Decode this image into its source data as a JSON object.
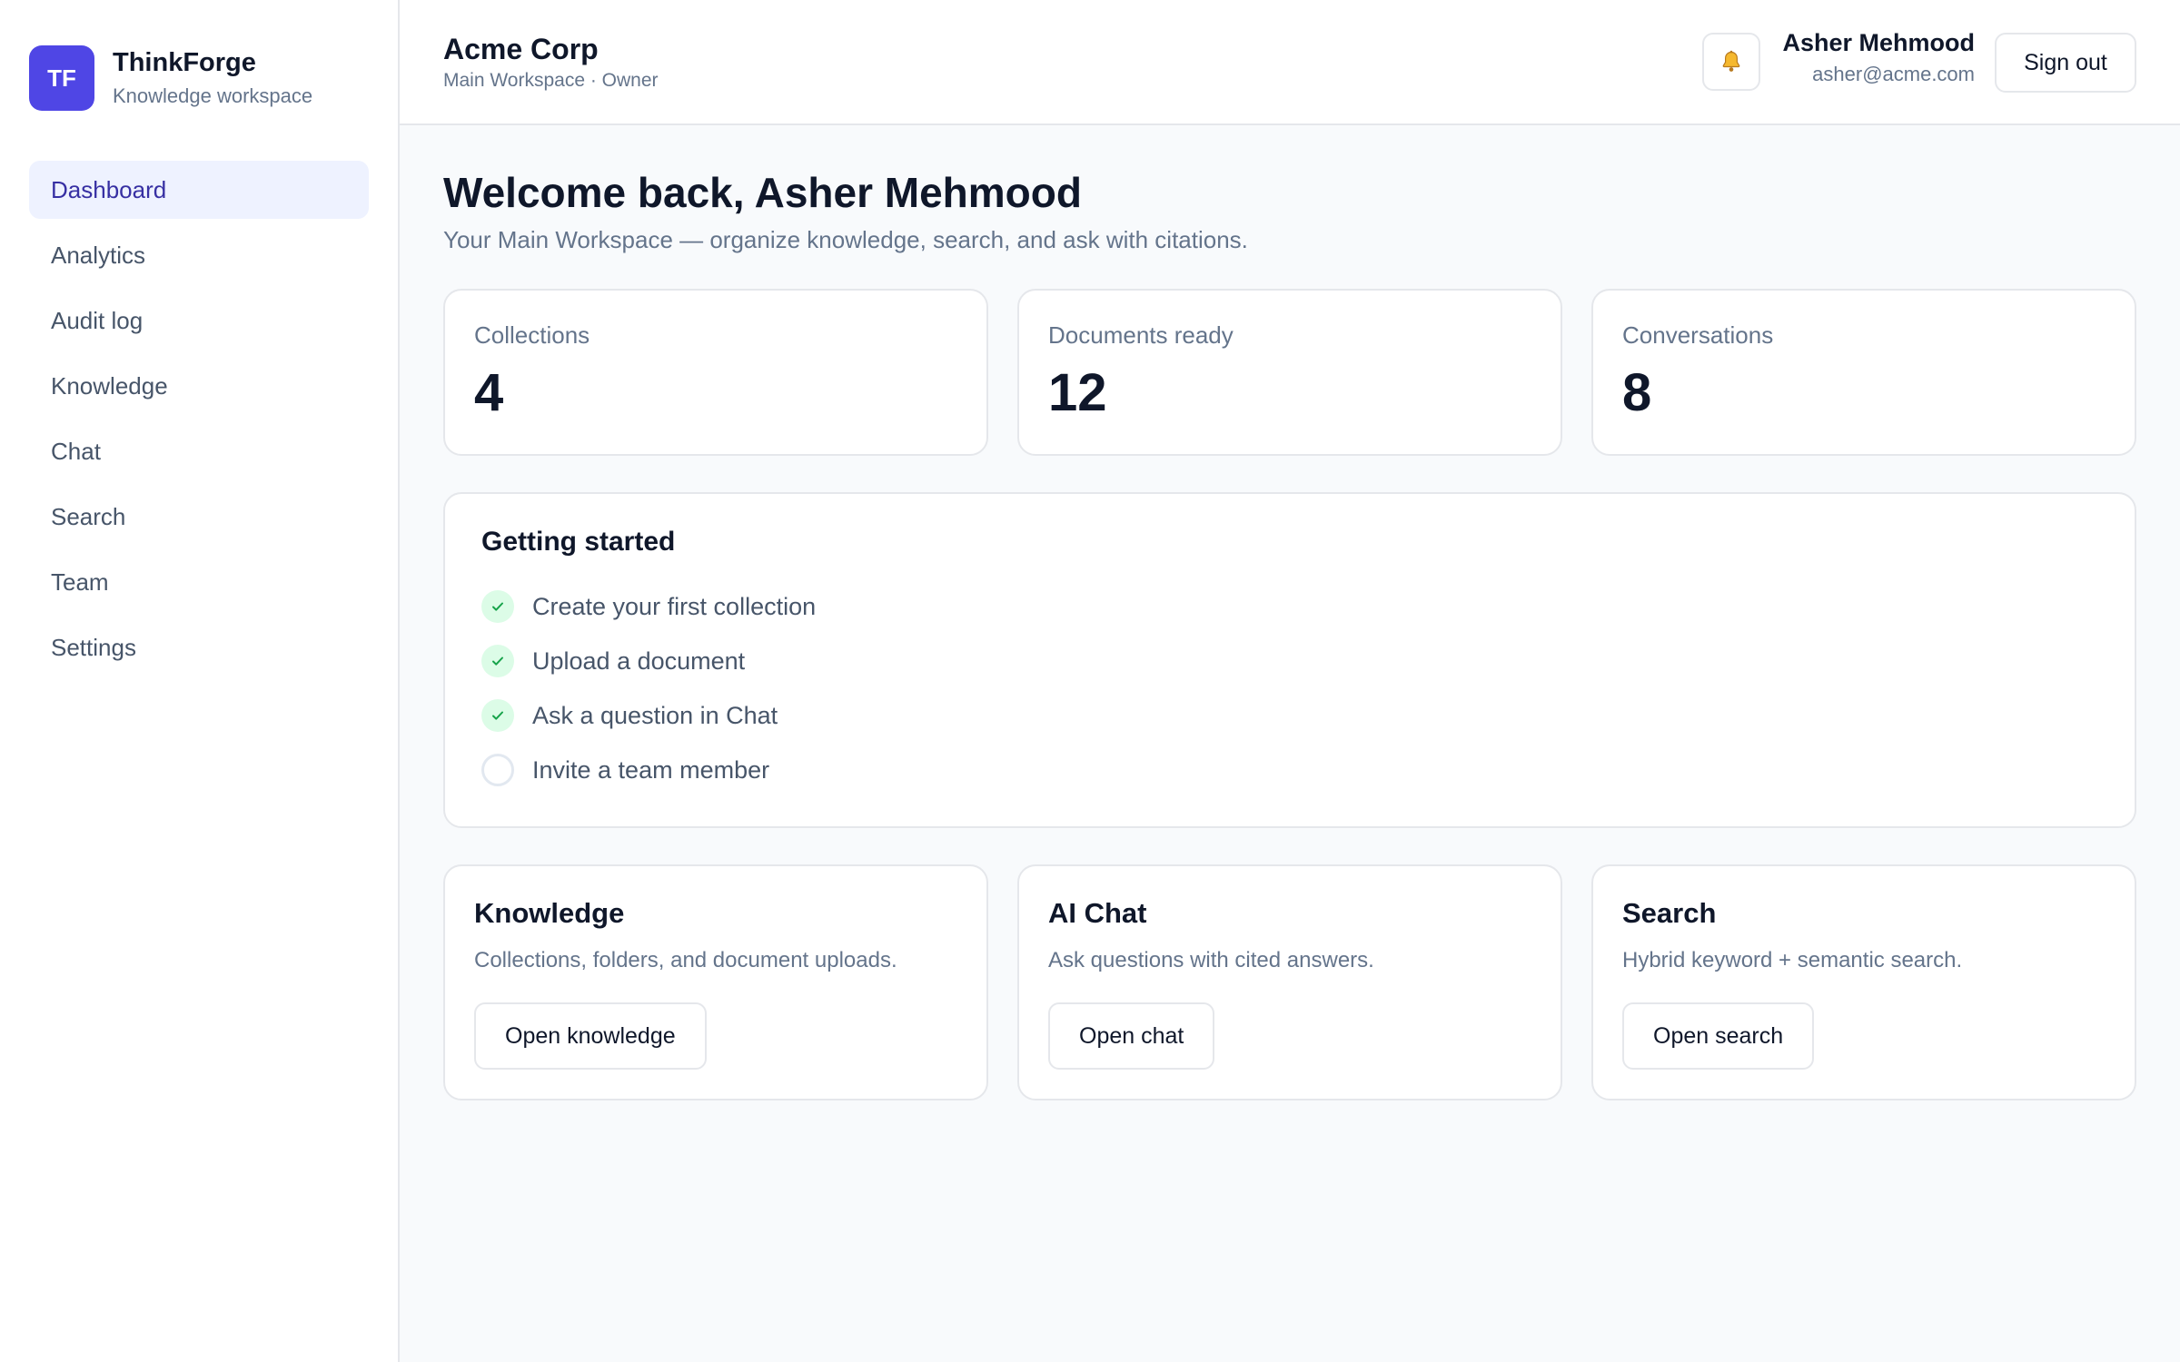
{
  "brand": {
    "logo": "TF",
    "name": "ThinkForge",
    "subtitle": "Knowledge workspace"
  },
  "nav": {
    "items": [
      {
        "label": "Dashboard",
        "active": true
      },
      {
        "label": "Analytics"
      },
      {
        "label": "Audit log"
      },
      {
        "label": "Knowledge"
      },
      {
        "label": "Chat"
      },
      {
        "label": "Search"
      },
      {
        "label": "Team"
      },
      {
        "label": "Settings"
      }
    ]
  },
  "header": {
    "org_name": "Acme Corp",
    "org_sub": "Main Workspace · Owner",
    "notifications_icon": "bell-icon",
    "user_name": "Asher Mehmood",
    "user_email": "asher@acme.com",
    "signout_label": "Sign out"
  },
  "welcome": {
    "title": "Welcome back, Asher Mehmood",
    "subtitle": "Your Main Workspace — organize knowledge, search, and ask with citations."
  },
  "stats": [
    {
      "label": "Collections",
      "value": "4"
    },
    {
      "label": "Documents ready",
      "value": "12"
    },
    {
      "label": "Conversations",
      "value": "8"
    }
  ],
  "getting_started": {
    "title": "Getting started",
    "items": [
      {
        "label": "Create your first collection",
        "done": true
      },
      {
        "label": "Upload a document",
        "done": true
      },
      {
        "label": "Ask a question in Chat",
        "done": true
      },
      {
        "label": "Invite a team member",
        "done": false
      }
    ]
  },
  "modules": [
    {
      "title": "Knowledge",
      "description": "Collections, folders, and document uploads.",
      "button": "Open knowledge"
    },
    {
      "title": "AI Chat",
      "description": "Ask questions with cited answers.",
      "button": "Open chat"
    },
    {
      "title": "Search",
      "description": "Hybrid keyword + semantic search.",
      "button": "Open search"
    }
  ],
  "colors": {
    "accent": "#4f46e5",
    "active_nav_bg": "#eef2ff",
    "active_nav_text": "#3730a3",
    "check_done_bg": "#dcfce7",
    "check_done_mark": "#16a34a"
  }
}
